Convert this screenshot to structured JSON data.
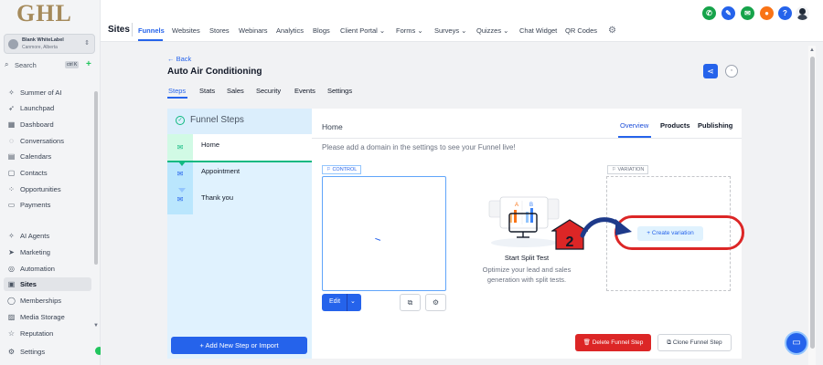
{
  "brand": {
    "logo_text": "GHL"
  },
  "account": {
    "name": "Blank WhiteLabel",
    "location": "Canmore, Alberta"
  },
  "search": {
    "label": "Search",
    "shortcut": "ctrl K",
    "quick_add": "+"
  },
  "sidebar": {
    "items": [
      {
        "label": "Summer of AI",
        "icon": "sparkle-icon",
        "glyph": "✧"
      },
      {
        "label": "Launchpad",
        "icon": "rocket-icon",
        "glyph": "➶"
      },
      {
        "label": "Dashboard",
        "icon": "dashboard-icon",
        "glyph": "▦"
      },
      {
        "label": "Conversations",
        "icon": "chat-icon",
        "glyph": "◌"
      },
      {
        "label": "Calendars",
        "icon": "calendar-icon",
        "glyph": "▤"
      },
      {
        "label": "Contacts",
        "icon": "contacts-icon",
        "glyph": "▢"
      },
      {
        "label": "Opportunities",
        "icon": "opportunities-icon",
        "glyph": "⁘"
      },
      {
        "label": "Payments",
        "icon": "payments-icon",
        "glyph": "▭"
      },
      {
        "label": "AI Agents",
        "icon": "ai-agents-icon",
        "glyph": "✧"
      },
      {
        "label": "Marketing",
        "icon": "send-icon",
        "glyph": "➤"
      },
      {
        "label": "Automation",
        "icon": "automation-icon",
        "glyph": "◎"
      },
      {
        "label": "Sites",
        "icon": "sites-icon",
        "glyph": "▣"
      },
      {
        "label": "Memberships",
        "icon": "memberships-icon",
        "glyph": "◯"
      },
      {
        "label": "Media Storage",
        "icon": "media-icon",
        "glyph": "▨"
      },
      {
        "label": "Reputation",
        "icon": "reputation-icon",
        "glyph": "☆"
      },
      {
        "label": "Settings",
        "icon": "gear-icon",
        "glyph": "⚙"
      }
    ],
    "active": "Sites"
  },
  "topbar": {
    "section": "Sites",
    "tabs": [
      "Funnels",
      "Websites",
      "Stores",
      "Webinars",
      "Analytics",
      "Blogs",
      "Client Portal ⌄",
      "Forms ⌄",
      "Surveys ⌄",
      "Quizzes ⌄",
      "Chat Widget",
      "QR Codes"
    ],
    "active_tab": "Funnels",
    "icons": [
      {
        "name": "phone-icon",
        "glyph": "✆",
        "color": "#16a34a"
      },
      {
        "name": "megaphone-icon",
        "glyph": "✎",
        "color": "#2563eb"
      },
      {
        "name": "announcement-icon",
        "glyph": "✉",
        "color": "#16a34a"
      },
      {
        "name": "notification-bell-icon",
        "glyph": "●",
        "color": "#f97316"
      },
      {
        "name": "help-icon",
        "glyph": "?",
        "color": "#2563eb"
      }
    ]
  },
  "funnel": {
    "back": "← Back",
    "title": "Auto Air Conditioning",
    "tabs": [
      "Steps",
      "Stats",
      "Sales",
      "Security",
      "Events",
      "Settings"
    ],
    "active_tab": "Steps"
  },
  "steps": {
    "header": "Funnel Steps",
    "items": [
      "Home",
      "Appointment",
      "Thank you"
    ],
    "add_button": "+ Add New Step or Import"
  },
  "page": {
    "name": "Home",
    "tabs": [
      "Overview",
      "Products",
      "Publishing"
    ],
    "active_tab": "Overview",
    "domain_message": "Please add a domain in the settings to see your Funnel live!",
    "control_tag": "⚐ CONTROL",
    "variation_tag": "⚐ VARIATION",
    "edit_button": "Edit",
    "split_test": {
      "title": "Start Split Test",
      "description": "Optimize your lead and sales generation with split tests."
    },
    "create_variation": "+ Create variation",
    "delete_button": "Delete Funnel Step",
    "clone_button": "Clone Funnel Step",
    "annotation_number": "2"
  },
  "colors": {
    "accent": "#2563eb",
    "danger": "#dc2626",
    "success": "#10b981",
    "logo": "#a58a5b"
  }
}
